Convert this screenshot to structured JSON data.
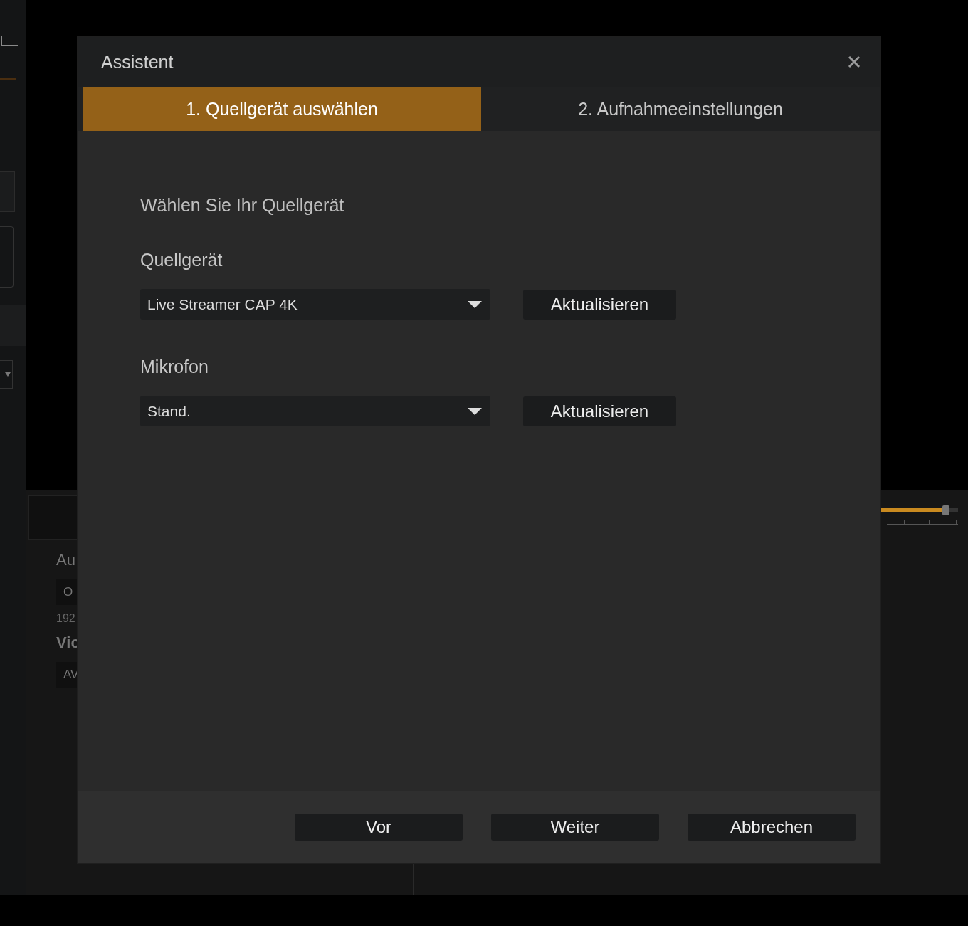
{
  "background": {
    "labels": [
      {
        "kind": "heading",
        "text": "Au"
      },
      {
        "kind": "chip",
        "text": "O"
      },
      {
        "kind": "note",
        "text": "192"
      },
      {
        "kind": "bold",
        "text": "Vic"
      },
      {
        "kind": "chip",
        "text": "AV"
      }
    ],
    "slider": {
      "level": 0.96
    }
  },
  "dialog": {
    "title": "Assistent",
    "tabs": [
      {
        "label": "1. Quellgerät auswählen",
        "selected": true
      },
      {
        "label": "2. Aufnahmeeinstellungen",
        "selected": false
      }
    ],
    "heading": "Wählen Sie Ihr Quellgerät",
    "fields": [
      {
        "label": "Quellgerät",
        "value": "Live Streamer CAP 4K",
        "button": "Aktualisieren"
      },
      {
        "label": "Mikrofon",
        "value": "Stand.",
        "button": "Aktualisieren"
      }
    ],
    "buttons": [
      "Vor",
      "Weiter",
      "Abbrechen"
    ]
  }
}
